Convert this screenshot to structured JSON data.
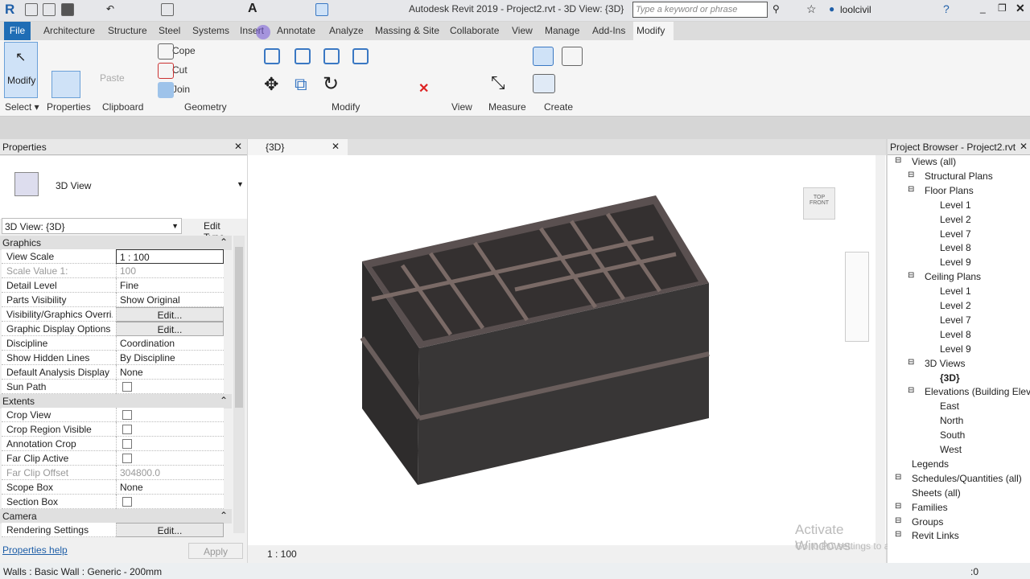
{
  "app": {
    "title": "Autodesk Revit 2019 - Project2.rvt - 3D View: {3D}",
    "search_placeholder": "Type a keyword or phrase",
    "user": "loolcivil"
  },
  "tabs": [
    "File",
    "Architecture",
    "Structure",
    "Steel",
    "Systems",
    "Insert",
    "Annotate",
    "Analyze",
    "Massing & Site",
    "Collaborate",
    "View",
    "Manage",
    "Add-Ins",
    "Modify"
  ],
  "ribbon": {
    "modify": "Modify",
    "select": "Select ▾",
    "properties": "Properties",
    "clipboard": "Clipboard",
    "paste": "Paste",
    "cope": "Cope",
    "cut": "Cut",
    "join": "Join",
    "geometry": "Geometry",
    "modify_panel": "Modify",
    "view": "View",
    "measure": "Measure",
    "create": "Create"
  },
  "properties": {
    "title": "Properties",
    "type": "3D View",
    "selector": "3D View: {3D}",
    "edit_type": "Edit Type",
    "graphics": "Graphics",
    "extents": "Extents",
    "camera": "Camera",
    "rows": [
      {
        "k": "View Scale",
        "v": "1 : 100"
      },
      {
        "k": "Scale Value    1:",
        "v": "100"
      },
      {
        "k": "Detail Level",
        "v": "Fine"
      },
      {
        "k": "Parts Visibility",
        "v": "Show Original"
      },
      {
        "k": "Visibility/Graphics Overri...",
        "v": "Edit..."
      },
      {
        "k": "Graphic Display Options",
        "v": "Edit..."
      },
      {
        "k": "Discipline",
        "v": "Coordination"
      },
      {
        "k": "Show Hidden Lines",
        "v": "By Discipline"
      },
      {
        "k": "Default Analysis Display ...",
        "v": "None"
      },
      {
        "k": "Sun Path",
        "v": ""
      }
    ],
    "rows2": [
      {
        "k": "Crop View",
        "v": ""
      },
      {
        "k": "Crop Region Visible",
        "v": ""
      },
      {
        "k": "Annotation Crop",
        "v": ""
      },
      {
        "k": "Far Clip Active",
        "v": ""
      },
      {
        "k": "Far Clip Offset",
        "v": "304800.0"
      },
      {
        "k": "Scope Box",
        "v": "None"
      },
      {
        "k": "Section Box",
        "v": ""
      }
    ],
    "rendering": {
      "k": "Rendering Settings",
      "v": "Edit..."
    },
    "help": "Properties help",
    "apply": "Apply"
  },
  "view": {
    "tab": "{3D}",
    "scale": "1 : 100",
    "cube_top": "TOP",
    "cube_front": "FRONT"
  },
  "browser": {
    "title": "Project Browser - Project2.rvt",
    "items": [
      {
        "t": "Views (all)",
        "l": 0
      },
      {
        "t": "Structural Plans",
        "l": 1
      },
      {
        "t": "Floor Plans",
        "l": 1
      },
      {
        "t": "Level 1",
        "l": 2
      },
      {
        "t": "Level 2",
        "l": 2
      },
      {
        "t": "Level 7",
        "l": 2
      },
      {
        "t": "Level 8",
        "l": 2
      },
      {
        "t": "Level 9",
        "l": 2
      },
      {
        "t": "Ceiling Plans",
        "l": 1
      },
      {
        "t": "Level 1",
        "l": 2
      },
      {
        "t": "Level 2",
        "l": 2
      },
      {
        "t": "Level 7",
        "l": 2
      },
      {
        "t": "Level 8",
        "l": 2
      },
      {
        "t": "Level 9",
        "l": 2
      },
      {
        "t": "3D Views",
        "l": 1
      },
      {
        "t": "{3D}",
        "l": 2
      },
      {
        "t": "Elevations (Building Elevat",
        "l": 1
      },
      {
        "t": "East",
        "l": 2
      },
      {
        "t": "North",
        "l": 2
      },
      {
        "t": "South",
        "l": 2
      },
      {
        "t": "West",
        "l": 2
      },
      {
        "t": "Legends",
        "l": 0
      },
      {
        "t": "Schedules/Quantities (all)",
        "l": 0
      },
      {
        "t": "Sheets (all)",
        "l": 0
      },
      {
        "t": "Families",
        "l": 0
      },
      {
        "t": "Groups",
        "l": 0
      },
      {
        "t": "Revit Links",
        "l": 0
      }
    ]
  },
  "watermark": {
    "line1": "Activate Windows",
    "line2": "Go to PC settings to activate Windows."
  },
  "status": {
    "text": "Walls : Basic Wall : Generic - 200mm",
    "filter": ":0"
  }
}
